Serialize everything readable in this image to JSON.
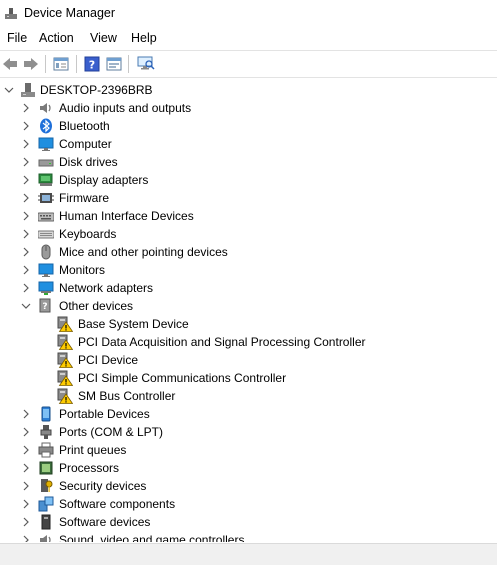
{
  "window": {
    "title": "Device Manager"
  },
  "menu": [
    "File",
    "Action",
    "View",
    "Help"
  ],
  "toolbar": [
    "back-icon",
    "forward-icon",
    "properties-icon",
    "help-icon",
    "update-driver-icon",
    "scan-hardware-icon"
  ],
  "tree": {
    "root": "DESKTOP-2396BRB",
    "categories": [
      {
        "label": "Audio inputs and outputs",
        "icon": "speaker-icon",
        "expanded": false
      },
      {
        "label": "Bluetooth",
        "icon": "bluetooth-icon",
        "expanded": false
      },
      {
        "label": "Computer",
        "icon": "monitor-icon",
        "expanded": false
      },
      {
        "label": "Disk drives",
        "icon": "disk-drive-icon",
        "expanded": false
      },
      {
        "label": "Display adapters",
        "icon": "display-adapter-icon",
        "expanded": false
      },
      {
        "label": "Firmware",
        "icon": "firmware-icon",
        "expanded": false
      },
      {
        "label": "Human Interface Devices",
        "icon": "hid-icon",
        "expanded": false
      },
      {
        "label": "Keyboards",
        "icon": "keyboard-icon",
        "expanded": false
      },
      {
        "label": "Mice and other pointing devices",
        "icon": "mouse-icon",
        "expanded": false
      },
      {
        "label": "Monitors",
        "icon": "monitor-icon",
        "expanded": false
      },
      {
        "label": "Network adapters",
        "icon": "network-icon",
        "expanded": false
      },
      {
        "label": "Other devices",
        "icon": "unknown-device-icon",
        "expanded": true,
        "children": [
          {
            "label": "Base System Device",
            "icon": "warning-device-icon"
          },
          {
            "label": "PCI Data Acquisition and Signal Processing Controller",
            "icon": "warning-device-icon"
          },
          {
            "label": "PCI Device",
            "icon": "warning-device-icon"
          },
          {
            "label": "PCI Simple Communications Controller",
            "icon": "warning-device-icon"
          },
          {
            "label": "SM Bus Controller",
            "icon": "warning-device-icon"
          }
        ]
      },
      {
        "label": "Portable Devices",
        "icon": "portable-device-icon",
        "expanded": false
      },
      {
        "label": "Ports (COM & LPT)",
        "icon": "port-icon",
        "expanded": false
      },
      {
        "label": "Print queues",
        "icon": "printer-icon",
        "expanded": false
      },
      {
        "label": "Processors",
        "icon": "processor-icon",
        "expanded": false
      },
      {
        "label": "Security devices",
        "icon": "security-icon",
        "expanded": false
      },
      {
        "label": "Software components",
        "icon": "software-component-icon",
        "expanded": false
      },
      {
        "label": "Software devices",
        "icon": "software-device-icon",
        "expanded": false
      },
      {
        "label": "Sound, video and game controllers",
        "icon": "sound-icon",
        "expanded": false
      }
    ]
  }
}
